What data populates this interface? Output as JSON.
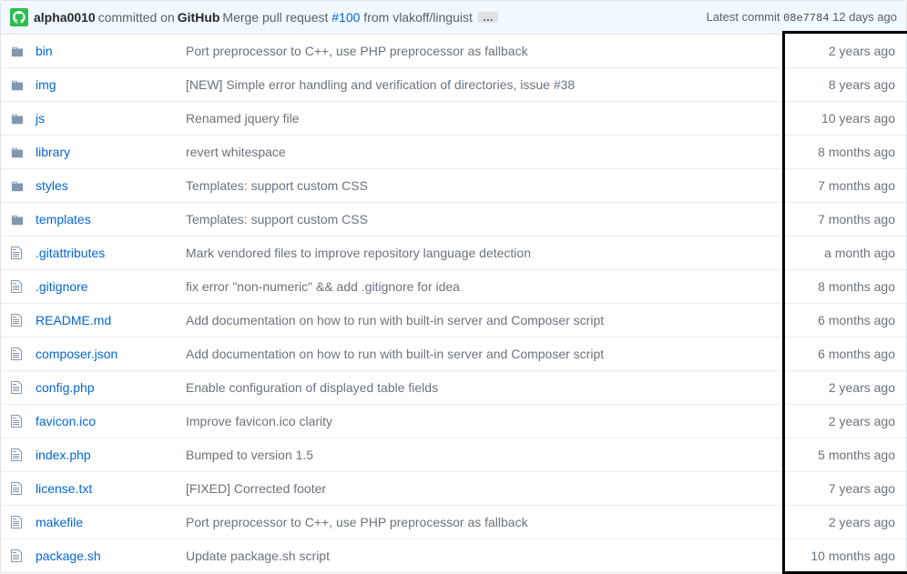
{
  "header": {
    "author": "alpha0010",
    "committed_on": "committed on",
    "github": "GitHub",
    "message_prefix": "Merge pull request ",
    "pr_number": "#100",
    "message_suffix": " from vlakoff/linguist",
    "ellipsis": "…",
    "latest_commit_label": "Latest commit ",
    "commit_sha": "08e7784",
    "commit_age": " 12 days ago"
  },
  "files": [
    {
      "type": "folder",
      "name": "bin",
      "message": "Port preprocessor to C++, use PHP preprocessor as fallback",
      "age": "2 years ago"
    },
    {
      "type": "folder",
      "name": "img",
      "message": "[NEW] Simple error handling and verification of directories, issue #38",
      "age": "8 years ago"
    },
    {
      "type": "folder",
      "name": "js",
      "message": "Renamed jquery file",
      "age": "10 years ago"
    },
    {
      "type": "folder",
      "name": "library",
      "message": "revert whitespace",
      "age": "8 months ago"
    },
    {
      "type": "folder",
      "name": "styles",
      "message": "Templates: support custom CSS",
      "age": "7 months ago"
    },
    {
      "type": "folder",
      "name": "templates",
      "message": "Templates: support custom CSS",
      "age": "7 months ago"
    },
    {
      "type": "file",
      "name": ".gitattributes",
      "message": "Mark vendored files to improve repository language detection",
      "age": "a month ago"
    },
    {
      "type": "file",
      "name": ".gitignore",
      "message": "fix error \"non-numeric\" && add .gitignore for idea",
      "age": "8 months ago"
    },
    {
      "type": "file",
      "name": "README.md",
      "message": "Add documentation on how to run with built-in server and Composer script",
      "age": "6 months ago"
    },
    {
      "type": "file",
      "name": "composer.json",
      "message": "Add documentation on how to run with built-in server and Composer script",
      "age": "6 months ago"
    },
    {
      "type": "file",
      "name": "config.php",
      "message": "Enable configuration of displayed table fields",
      "age": "2 years ago"
    },
    {
      "type": "file",
      "name": "favicon.ico",
      "message": "Improve favicon.ico clarity",
      "age": "2 years ago"
    },
    {
      "type": "file",
      "name": "index.php",
      "message": "Bumped to version 1.5",
      "age": "5 months ago"
    },
    {
      "type": "file",
      "name": "license.txt",
      "message": "[FIXED] Corrected footer",
      "age": "7 years ago"
    },
    {
      "type": "file",
      "name": "makefile",
      "message": "Port preprocessor to C++, use PHP preprocessor as fallback",
      "age": "2 years ago"
    },
    {
      "type": "file",
      "name": "package.sh",
      "message": "Update package.sh script",
      "age": "10 months ago"
    }
  ]
}
